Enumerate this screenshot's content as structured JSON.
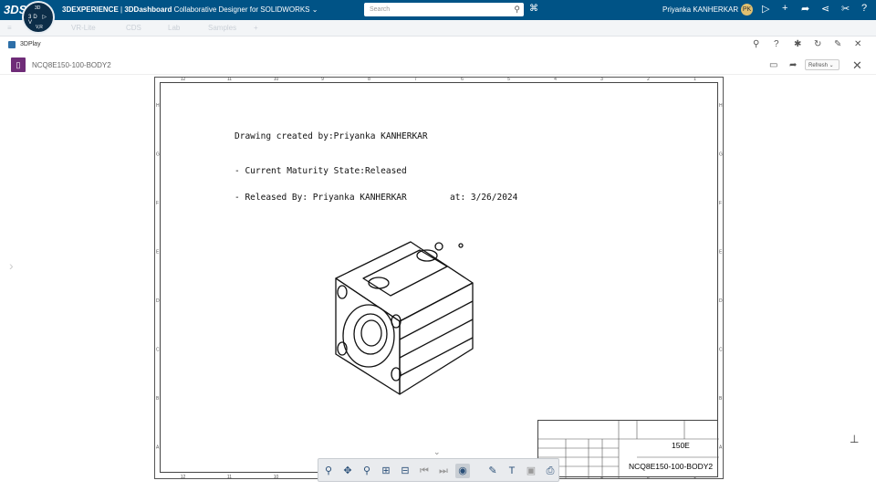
{
  "topbar": {
    "logo": "3DS",
    "compass_top": "3D",
    "compass_mid": "3D ▷ V",
    "compass_bottom": "V,R",
    "brand_bold": "3DEXPERIENCE",
    "brand_sep": " | ",
    "dashboard": "3DDashboard",
    "app_name": "Collaborative Designer for SOLIDWORKS",
    "search_placeholder": "Search",
    "user_name": "Priyanka KANHERKAR",
    "avatar": "PK"
  },
  "tabs": [
    "VR-Lite",
    "CDS",
    "Lab",
    "Samples"
  ],
  "panel": {
    "title": "3DPlay"
  },
  "document": {
    "name": "NCQ8E150-100-BODY2",
    "refresh_label": "Refresh"
  },
  "drawing": {
    "created_by": "Drawing created by:Priyanka KANHERKAR",
    "maturity": "- Current Maturity State:Released",
    "released_by": "- Released By: Priyanka KANHERKAR",
    "released_at": "at: 3/26/2024",
    "col_labels_top": [
      "12",
      "11",
      "10",
      "9",
      "8",
      "7",
      "6",
      "5",
      "4",
      "3",
      "2",
      "1"
    ],
    "row_labels": [
      "H",
      "G",
      "F",
      "E",
      "D",
      "C",
      "B",
      "A"
    ],
    "title_block_number": "150E",
    "title_block_part": "NCQ8E150-100-BODY2"
  },
  "colors": {
    "topbar": "#005386",
    "doc_icon": "#6f2c78"
  }
}
